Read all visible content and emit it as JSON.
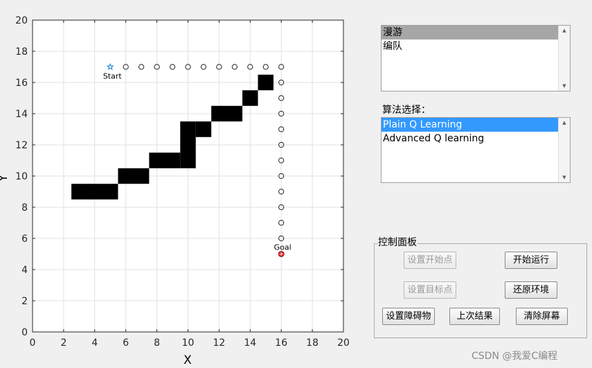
{
  "plot": {
    "xlabel": "X",
    "ylabel": "Y",
    "xlim": [
      0,
      20
    ],
    "ylim": [
      0,
      20
    ],
    "ticks": [
      0,
      2,
      4,
      6,
      8,
      10,
      12,
      14,
      16,
      18,
      20
    ],
    "grid": true,
    "start": {
      "label": "Start",
      "x": 5,
      "y": 17,
      "color": "#1f8ad6"
    },
    "goal": {
      "label": "Goal",
      "x": 16,
      "y": 5,
      "color": "#e02020"
    },
    "obstacle_color": "#000000",
    "obstacles": [
      {
        "x0": 2.5,
        "x1": 5.5,
        "y0": 8.5,
        "y1": 9.5
      },
      {
        "x0": 5.5,
        "x1": 7.5,
        "y0": 9.5,
        "y1": 10.5
      },
      {
        "x0": 7.5,
        "x1": 9.5,
        "y0": 10.5,
        "y1": 11.5
      },
      {
        "x0": 9.5,
        "x1": 10.5,
        "y0": 10.5,
        "y1": 13.5
      },
      {
        "x0": 10.5,
        "x1": 11.5,
        "y0": 12.5,
        "y1": 13.5
      },
      {
        "x0": 11.5,
        "x1": 13.5,
        "y0": 13.5,
        "y1": 14.5
      },
      {
        "x0": 13.5,
        "x1": 14.5,
        "y0": 14.5,
        "y1": 15.5
      },
      {
        "x0": 14.5,
        "x1": 15.5,
        "y0": 15.5,
        "y1": 16.5
      }
    ],
    "path": [
      [
        6,
        17
      ],
      [
        7,
        17
      ],
      [
        8,
        17
      ],
      [
        9,
        17
      ],
      [
        10,
        17
      ],
      [
        11,
        17
      ],
      [
        12,
        17
      ],
      [
        13,
        17
      ],
      [
        14,
        17
      ],
      [
        15,
        17
      ],
      [
        16,
        17
      ],
      [
        16,
        16
      ],
      [
        16,
        15
      ],
      [
        16,
        14
      ],
      [
        16,
        13
      ],
      [
        16,
        12
      ],
      [
        16,
        11
      ],
      [
        16,
        10
      ],
      [
        16,
        9
      ],
      [
        16,
        8
      ],
      [
        16,
        7
      ],
      [
        16,
        6
      ]
    ]
  },
  "mode_list": {
    "items": [
      "漫游",
      "编队"
    ],
    "selected": 0,
    "scroll_up_icon": "triangle-up",
    "scroll_down_icon": "triangle-down"
  },
  "algo_label": "算法选择：",
  "algo_list": {
    "items": [
      "Plain Q Learning",
      "Advanced Q learning"
    ],
    "selected": 0
  },
  "control_panel": {
    "title": "控制面板",
    "set_start": "设置开始点",
    "set_goal": "设置目标点",
    "set_obstacle": "设置障碍物",
    "start_run": "开始运行",
    "reset_env": "还原环境",
    "last_result": "上次结果",
    "clear_screen": "清除屏幕"
  },
  "watermark": "CSDN @我爱C编程"
}
